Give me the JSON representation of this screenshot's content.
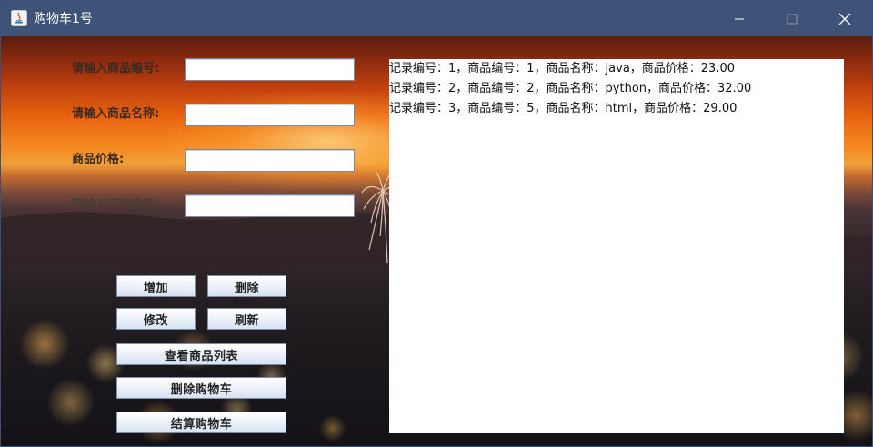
{
  "window": {
    "title": "购物车1号",
    "controls": {
      "minimize": "minimize-icon",
      "maximize": "maximize-icon",
      "close": "close-icon"
    }
  },
  "form": {
    "product_id_label": "请输入商品编号:",
    "product_name_label": "请输入商品名称:",
    "price_label": "商品价格:",
    "record_id_label": "请输入记录编号:",
    "product_id_value": "",
    "product_name_value": "",
    "price_value": "",
    "record_id_value": ""
  },
  "buttons": {
    "add": "增加",
    "delete": "删除",
    "modify": "修改",
    "refresh": "刷新",
    "view_products": "查看商品列表",
    "delete_cart": "删除购物车",
    "checkout_cart": "结算购物车"
  },
  "records": [
    "记录编号：1，商品编号：1，商品名称：java，商品价格：23.00",
    "记录编号：2，商品编号：2，商品名称：python，商品价格：32.00",
    "记录编号：3，商品编号：5，商品名称：html，商品价格：29.00"
  ],
  "colors": {
    "titlebar": "#3e5377",
    "button_top": "#ffffff",
    "button_bottom": "#d6e2f1",
    "list_background": "#ffffff"
  }
}
